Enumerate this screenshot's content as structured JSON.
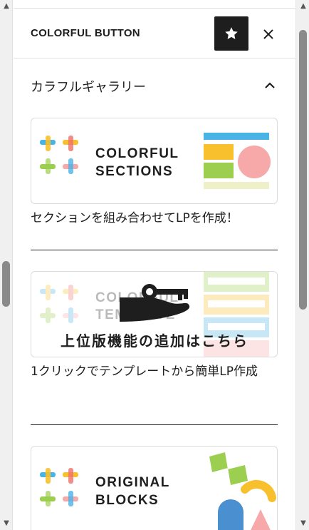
{
  "header": {
    "title": "COLORFUL BUTTON"
  },
  "section": {
    "title": "カラフルギャラリー"
  },
  "gallery": [
    {
      "logo_line1": "COLORFUL",
      "logo_line2": "SECTIONS",
      "caption": "セクションを組み合わせてLPを作成！"
    },
    {
      "logo_line1": "COLORFUL",
      "logo_line2": "TEMPLATE",
      "overlay": "上位版機能の追加はこちら",
      "caption": "1クリックでテンプレートから簡単LP作成"
    },
    {
      "logo_line1": "ORIGINAL",
      "logo_line2": "BLOCKS"
    }
  ],
  "icons": {
    "star": "star-icon",
    "close": "close-icon",
    "collapse": "chevron-up-icon",
    "key_hand": "key-hand-icon"
  },
  "colors": {
    "dark": "#1e1e1e",
    "blue": "#4ab3e6",
    "yellow": "#f7c02c",
    "green": "#9cce4f",
    "pink": "#f7a8a8",
    "red": "#ef6f6c"
  }
}
